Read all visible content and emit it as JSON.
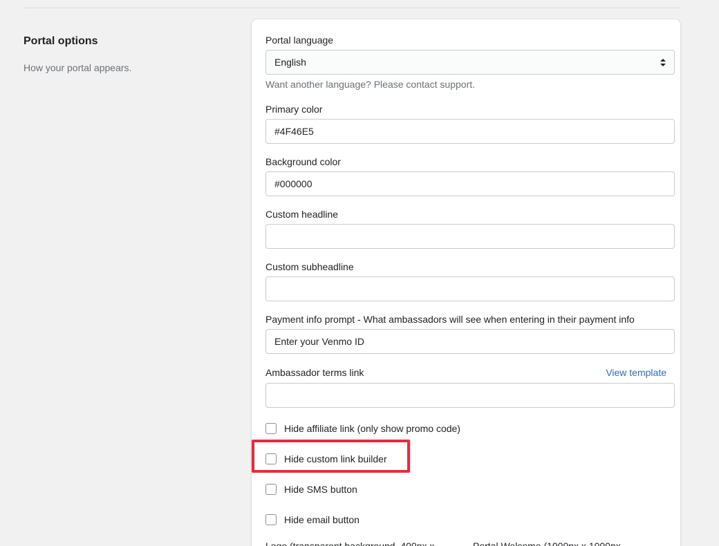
{
  "section": {
    "title": "Portal options",
    "description": "How your portal appears."
  },
  "fields": {
    "language": {
      "label": "Portal language",
      "value": "English",
      "help": "Want another language? Please contact support."
    },
    "primary_color": {
      "label": "Primary color",
      "value": "#4F46E5"
    },
    "background_color": {
      "label": "Background color",
      "value": "#000000"
    },
    "custom_headline": {
      "label": "Custom headline",
      "value": ""
    },
    "custom_subheadline": {
      "label": "Custom subheadline",
      "value": ""
    },
    "payment_prompt": {
      "label": "Payment info prompt - What ambassadors will see when entering in their payment info",
      "value": "Enter your Venmo ID"
    },
    "terms_link": {
      "label": "Ambassador terms link",
      "link_text": "View template",
      "value": ""
    }
  },
  "checkboxes": [
    {
      "label": "Hide affiliate link (only show promo code)",
      "checked": false
    },
    {
      "label": "Hide custom link builder",
      "checked": false
    },
    {
      "label": "Hide SMS button",
      "checked": false
    },
    {
      "label": "Hide email button",
      "checked": false
    }
  ],
  "bottom": {
    "logo_label": "Logo (transparent background, 400px x",
    "welcome_label": "Portal Welcome (1000px x 1000px"
  },
  "colors": {
    "highlight": "#f0283c",
    "link": "#2c6ecb"
  }
}
